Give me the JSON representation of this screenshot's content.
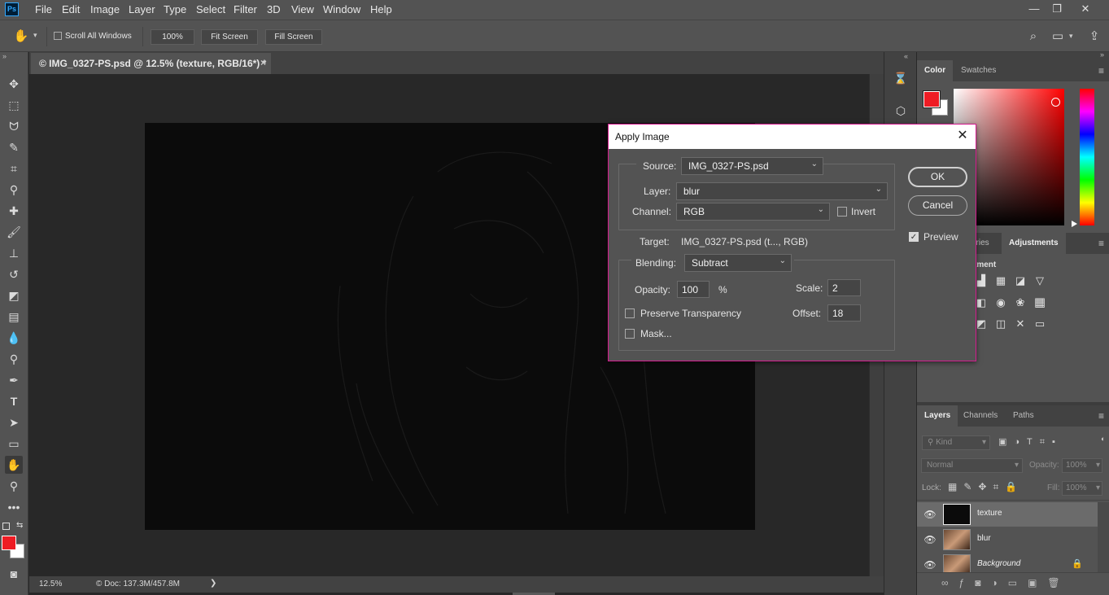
{
  "app": {
    "logo": "Ps"
  },
  "menu": [
    "File",
    "Edit",
    "Image",
    "Layer",
    "Type",
    "Select",
    "Filter",
    "3D",
    "View",
    "Window",
    "Help"
  ],
  "window_controls": {
    "minimize": "—",
    "restore": "❐",
    "close": "✕"
  },
  "options": {
    "scroll_all_windows": "Scroll All Windows",
    "zoom_100": "100%",
    "fit_screen": "Fit Screen",
    "fill_screen": "Fill Screen"
  },
  "document": {
    "tab_title": "© IMG_0327-PS.psd @ 12.5% (texture, RGB/16*) *",
    "tab_close": "×",
    "zoom": "12.5%",
    "doc_info": "© Doc: 137.3M/457.8M",
    "status_arrow": "❯"
  },
  "panels": {
    "color_tabs": [
      "Color",
      "Swatches"
    ],
    "adjust_tabs": [
      "aries",
      "Adjustments"
    ],
    "adjust_heading": "tment",
    "layers_tabs": [
      "Layers",
      "Channels",
      "Paths"
    ],
    "kind_filter": "Kind",
    "blend_mode": "Normal",
    "opacity_label": "Opacity:",
    "opacity_value": "100%",
    "lock_label": "Lock:",
    "fill_label": "Fill:",
    "fill_value": "100%",
    "layers": [
      {
        "name": "texture",
        "selected": true
      },
      {
        "name": "blur",
        "selected": false
      },
      {
        "name": "Background",
        "selected": false,
        "locked": true
      }
    ]
  },
  "colors": {
    "foreground": "#ee1c24",
    "background": "#ffffff",
    "accent_border": "#d51b8f"
  },
  "dialog": {
    "title": "Apply Image",
    "close": "✕",
    "source_label": "Source:",
    "source_value": "IMG_0327-PS.psd",
    "layer_label": "Layer:",
    "layer_value": "blur",
    "channel_label": "Channel:",
    "channel_value": "RGB",
    "invert_label": "Invert",
    "invert_checked": false,
    "target_label": "Target:",
    "target_value": "IMG_0327-PS.psd (t..., RGB)",
    "blending_label": "Blending:",
    "blending_value": "Subtract",
    "opacity_label": "Opacity:",
    "opacity_value": "100",
    "percent": "%",
    "scale_label": "Scale:",
    "scale_value": "2",
    "offset_label": "Offset:",
    "offset_value": "18",
    "preserve_transparency": "Preserve Transparency",
    "preserve_checked": false,
    "mask_label": "Mask...",
    "mask_checked": false,
    "ok": "OK",
    "cancel": "Cancel",
    "preview": "Preview",
    "preview_checked": true
  }
}
